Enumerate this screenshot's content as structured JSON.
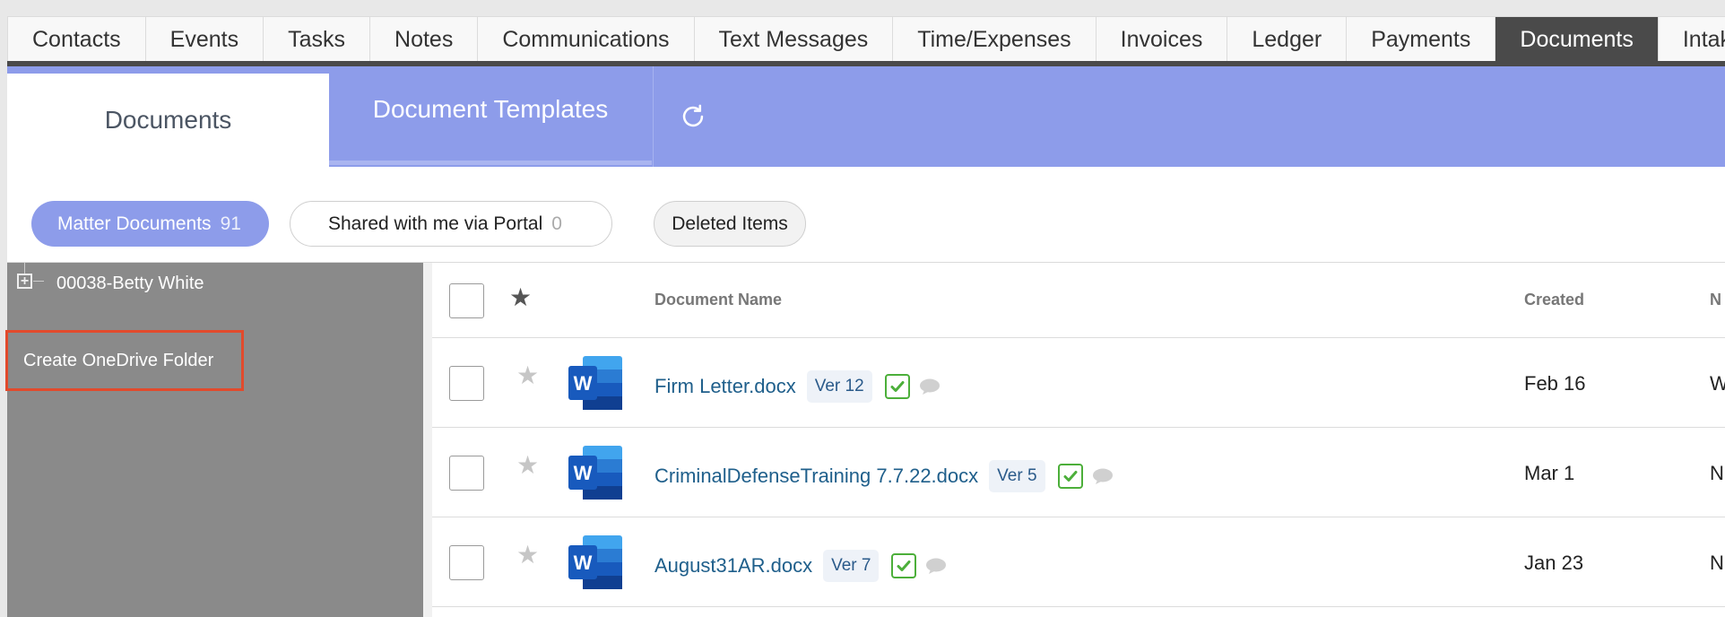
{
  "top_tabs": [
    {
      "label": "Contacts",
      "active": false
    },
    {
      "label": "Events",
      "active": false
    },
    {
      "label": "Tasks",
      "active": false
    },
    {
      "label": "Notes",
      "active": false
    },
    {
      "label": "Communications",
      "active": false
    },
    {
      "label": "Text Messages",
      "active": false
    },
    {
      "label": "Time/Expenses",
      "active": false
    },
    {
      "label": "Invoices",
      "active": false
    },
    {
      "label": "Ledger",
      "active": false
    },
    {
      "label": "Payments",
      "active": false
    },
    {
      "label": "Documents",
      "active": true
    },
    {
      "label": "Intak",
      "active": false
    }
  ],
  "sub_tabs": {
    "documents": "Documents",
    "templates": "Document Templates",
    "refresh_icon": "refresh-icon"
  },
  "filters": {
    "matter_label": "Matter Documents",
    "matter_count": "91",
    "shared_label": "Shared with me via Portal",
    "shared_count": "0",
    "deleted_label": "Deleted Items"
  },
  "sidebar": {
    "tree_item": "00038-Betty White",
    "onedrive_button": "Create OneDrive Folder"
  },
  "table": {
    "headers": {
      "name": "Document Name",
      "created": "Created",
      "next_cut": "N"
    },
    "rows": [
      {
        "name": "Firm Letter.docx",
        "version": "Ver 12",
        "created": "Feb 16",
        "next_cut": "W"
      },
      {
        "name": "CriminalDefenseTraining 7.7.22.docx",
        "version": "Ver 5",
        "created": "Mar 1",
        "next_cut": "N"
      },
      {
        "name": "August31AR.docx",
        "version": "Ver 7",
        "created": "Jan 23",
        "next_cut": "N"
      }
    ]
  },
  "colors": {
    "accent": "#8d9cea",
    "active_tab": "#4a4a4a",
    "highlight_border": "#e24a2c",
    "link": "#1f5f8b",
    "check_green": "#4caf3a"
  }
}
